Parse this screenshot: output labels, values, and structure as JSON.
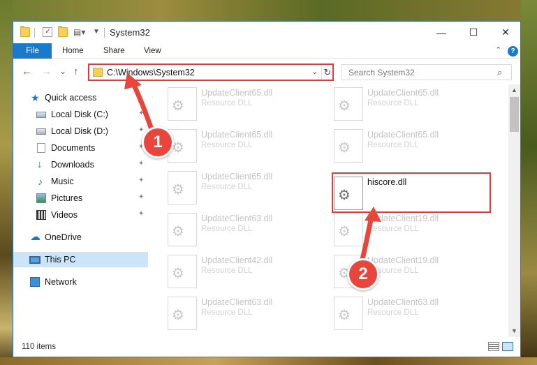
{
  "window": {
    "title": "System32",
    "controls": {
      "minimize": "—",
      "maximize": "☐",
      "close": "✕"
    }
  },
  "ribbon": {
    "tabs": [
      "File",
      "Home",
      "Share",
      "View"
    ],
    "collapse_icon": "chevron-up-icon",
    "help_icon": "?"
  },
  "navigation": {
    "back": "←",
    "forward": "→",
    "recent": "⌄",
    "up": "↑",
    "address": "C:\\Windows\\System32",
    "address_dropdown": "⌄",
    "refresh": "↻",
    "search_placeholder": "Search System32",
    "search_icon": "⌕"
  },
  "sidebar": {
    "items": [
      {
        "label": "Quick access",
        "icon": "star-icon",
        "glyph": "★",
        "pinned": false
      },
      {
        "label": "Local Disk (C:)",
        "icon": "disk-icon",
        "glyph": "",
        "pinned": true
      },
      {
        "label": "Local Disk (D:)",
        "icon": "disk-icon",
        "glyph": "",
        "pinned": true
      },
      {
        "label": "Documents",
        "icon": "documents-icon",
        "glyph": "",
        "pinned": true
      },
      {
        "label": "Downloads",
        "icon": "download-icon",
        "glyph": "↓",
        "pinned": true
      },
      {
        "label": "Music",
        "icon": "music-icon",
        "glyph": "♪",
        "pinned": true
      },
      {
        "label": "Pictures",
        "icon": "pictures-icon",
        "glyph": "",
        "pinned": true
      },
      {
        "label": "Videos",
        "icon": "video-icon",
        "glyph": "",
        "pinned": true
      },
      {
        "label": "OneDrive",
        "icon": "cloud-icon",
        "glyph": "☁",
        "pinned": false
      },
      {
        "label": "This PC",
        "icon": "computer-icon",
        "glyph": "",
        "pinned": false,
        "selected": true
      },
      {
        "label": "Network",
        "icon": "network-icon",
        "glyph": "",
        "pinned": false
      }
    ],
    "pin_glyph": "📌"
  },
  "files": [
    {
      "name": "UpdateClient65.dll",
      "type": "Resource DLL"
    },
    {
      "name": "UpdateClient65.dll",
      "type": "Resource DLL"
    },
    {
      "name": "UpdateClient65.dll",
      "type": "Resource DLL"
    },
    {
      "name": "UpdateClient65.dll",
      "type": "Resource DLL"
    },
    {
      "name": "UpdateClient65.dll",
      "type": "Resource DLL"
    },
    {
      "name": "hiscore.dll",
      "type": "",
      "highlighted": true
    },
    {
      "name": "UpdateClient63.dll",
      "type": "Resource DLL"
    },
    {
      "name": "UpdateClient19.dll",
      "type": "Resource DLL"
    },
    {
      "name": "UpdateClient42.dll",
      "type": "Resource DLL"
    },
    {
      "name": "UpdateClient19.dll",
      "type": "Resource DLL"
    },
    {
      "name": "UpdateClient63.dll",
      "type": "Resource DLL"
    },
    {
      "name": "UpdateClient63.dll",
      "type": "Resource DLL"
    }
  ],
  "file_icon_glyph": "⚙",
  "status": {
    "item_count": "110 items"
  },
  "annotations": {
    "step1": "1",
    "step2": "2",
    "accent": "#e2393b"
  }
}
